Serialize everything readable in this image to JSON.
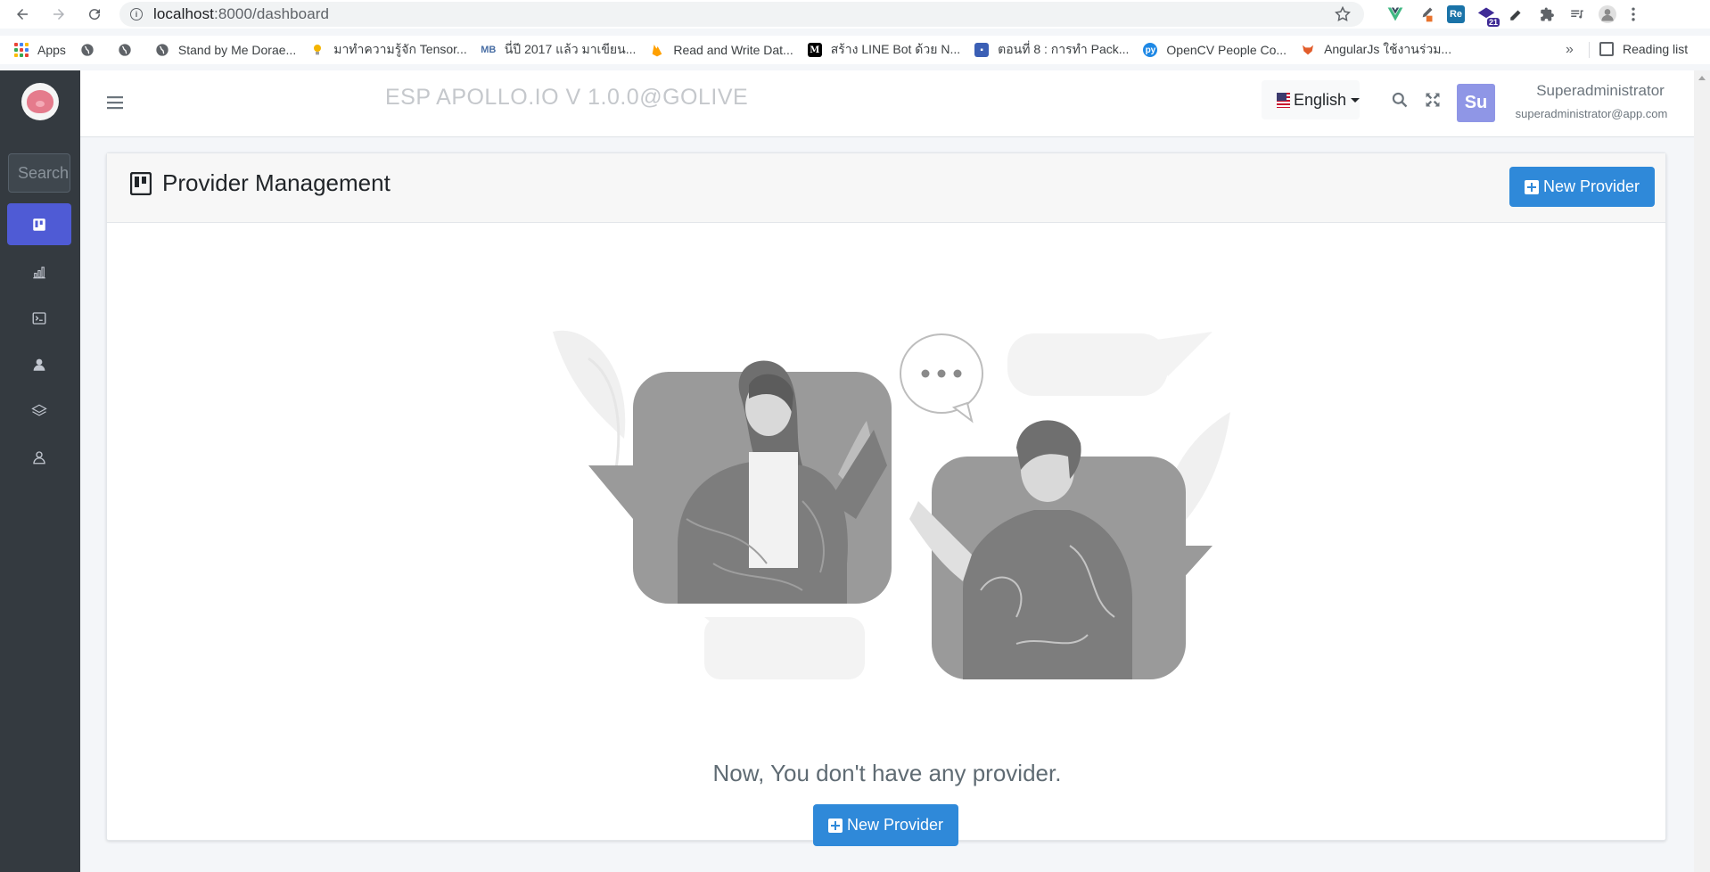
{
  "browser": {
    "url_host": "localhost",
    "url_path": ":8000/dashboard",
    "extensions": [
      {
        "name": "vue-devtools-icon",
        "color": "#41b883",
        "text": "V"
      },
      {
        "name": "colorpick-icon",
        "color": "#e8722c",
        "text": ""
      },
      {
        "name": "readlang-icon",
        "color": "#1a73a8",
        "text": "Re"
      },
      {
        "name": "scholar-icon",
        "color": "#3f2b96",
        "text": "",
        "badge": "21"
      },
      {
        "name": "pencil-icon",
        "color": "#5f6368",
        "text": ""
      },
      {
        "name": "extensions-puzzle-icon",
        "color": "#5f6368",
        "text": ""
      },
      {
        "name": "media-queue-icon",
        "color": "#5f6368",
        "text": ""
      },
      {
        "name": "profile-icon",
        "color": "#9aa0a6",
        "text": ""
      }
    ],
    "bookmarks": [
      {
        "label": "Apps",
        "icon": "apps-grid-icon"
      },
      {
        "label": "",
        "icon": "globe-icon"
      },
      {
        "label": "",
        "icon": "globe-icon"
      },
      {
        "label": "Stand by Me Dorae...",
        "icon": "globe-icon"
      },
      {
        "label": "มาทำความรู้จัก Tensor...",
        "icon": "bulb-icon"
      },
      {
        "label": "นี่ปี 2017 แล้ว มาเขียน...",
        "icon": "mb-icon"
      },
      {
        "label": "Read and Write Dat...",
        "icon": "firebase-icon"
      },
      {
        "label": "สร้าง LINE Bot ด้วย N...",
        "icon": "medium-icon"
      },
      {
        "label": "ตอนที่ 8 : การทำ Pack...",
        "icon": "doc-icon"
      },
      {
        "label": "OpenCV People Co...",
        "icon": "pyimagesearch-icon"
      },
      {
        "label": "AngularJs ใช้งานร่วม...",
        "icon": "fox-icon"
      }
    ],
    "more": "»",
    "reading_list": "Reading list"
  },
  "sidebar": {
    "search_placeholder": "Search",
    "items": [
      {
        "name": "sidebar-item-providers",
        "icon": "board-icon",
        "active": true
      },
      {
        "name": "sidebar-item-analytics",
        "icon": "bar-chart-icon",
        "active": false
      },
      {
        "name": "sidebar-item-console",
        "icon": "terminal-icon",
        "active": false
      },
      {
        "name": "sidebar-item-users",
        "icon": "user-icon",
        "active": false
      },
      {
        "name": "sidebar-item-layers",
        "icon": "layers-icon",
        "active": false
      },
      {
        "name": "sidebar-item-account",
        "icon": "user-outline-icon",
        "active": false
      }
    ]
  },
  "topbar": {
    "brand": "ESP APOLLO.IO V 1.0.0@GOLIVE",
    "language": "English",
    "avatar_initials": "Su",
    "user_name": "Superadministrator",
    "user_email": "superadministrator@app.com"
  },
  "card": {
    "title": "Provider Management",
    "new_button": "New Provider",
    "empty_message": "Now, You don't have any provider.",
    "empty_button": "New Provider"
  },
  "colors": {
    "sidebar_bg": "#343a40",
    "active_item": "#4f5bd5",
    "primary": "#2f89d9",
    "avatar": "#8f96e6"
  }
}
